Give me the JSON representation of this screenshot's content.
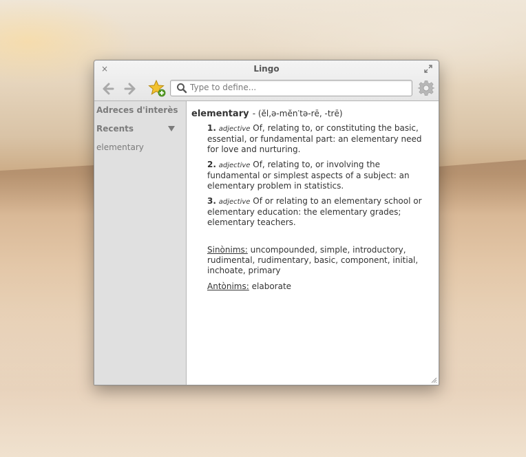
{
  "window": {
    "title": "Lingo"
  },
  "toolbar": {
    "close_glyph": "×",
    "back_icon": "arrow-left-icon",
    "forward_icon": "arrow-right-icon",
    "bookmark_icon": "star-add-icon",
    "settings_icon": "gear-icon",
    "search_placeholder": "Type to define..."
  },
  "sidebar": {
    "bookmarks_heading": "Adreces d'interès",
    "recents_heading": "Recents",
    "recent_items": [
      "elementary"
    ]
  },
  "entry": {
    "headword": "elementary",
    "pronunciation": "- (ĕl,ə-mĕn′tə-rē, -trē)",
    "definitions": [
      {
        "number": "1.",
        "pos": "adjective",
        "text": "Of, relating to, or constituting the basic, essential, or fundamental part:  an elementary need for love and nurturing."
      },
      {
        "number": "2.",
        "pos": "adjective",
        "text": "Of, relating to, or involving the fundamental or simplest aspects of a subject:  an elementary problem in statistics."
      },
      {
        "number": "3.",
        "pos": "adjective",
        "text": "Of or relating to an elementary school or elementary education:  the elementary grades; elementary teachers."
      }
    ],
    "synonyms_label": "Sinònims:",
    "synonyms": "uncompounded, simple, introductory, rudimental, rudimentary, basic, component, initial, inchoate, primary",
    "antonyms_label": "Antònims:",
    "antonyms": "elaborate"
  },
  "colors": {
    "sidebar_bg": "#e0e0e0",
    "sidebar_text": "#7b7b7b",
    "bookmark_star": "#f2c230"
  }
}
